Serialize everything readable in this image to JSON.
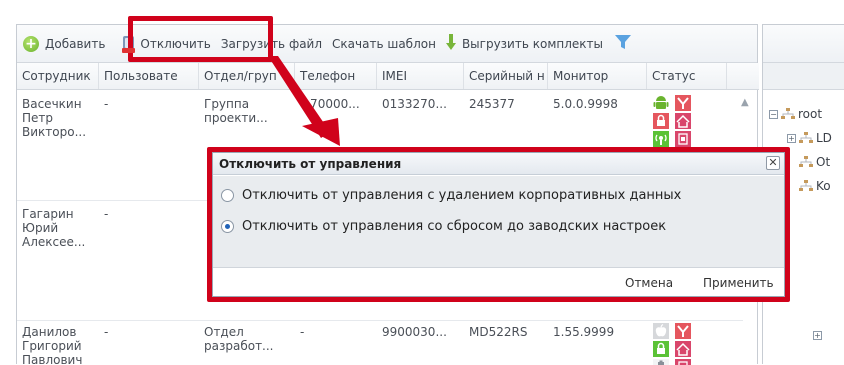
{
  "toolbar": {
    "add_label": "Добавить",
    "disable_label": "Отключить",
    "upload_label": "Загрузить файл",
    "download_template_label": "Скачать шаблон",
    "export_label": "Выгрузить комплекты"
  },
  "columns": [
    "Сотрудник",
    "Пользовате",
    "Отдел/груп",
    "Телефон",
    "IMEI",
    "Серийный н",
    "Монитор",
    "Статус"
  ],
  "rows": [
    {
      "employee": "Васечкин\nПетр\nВикторо...",
      "user": "-",
      "department": "Группа\nпроекти...",
      "phone": "+70000...",
      "imei": "0133270...",
      "serial": "245377",
      "monitor": "5.0.0.9998",
      "status_icons": [
        "android-icon",
        "antenna-icon",
        "lock-icon",
        "wifi-icon",
        "signal-icon",
        "sim-icon"
      ]
    },
    {
      "employee": "Гагарин\nЮрий\nАлексее...",
      "user": "-",
      "department": "",
      "phone": "",
      "imei": "",
      "serial": "",
      "monitor": "",
      "status_icons": []
    },
    {
      "employee": "Данилов\nГригорий\nПавлович",
      "user": "-",
      "department": "Отдел\nразработ...",
      "phone": "-",
      "imei": "9900030...",
      "serial": "MD522RS",
      "monitor": "1.55.9999",
      "status_icons": [
        "apple-icon",
        "antenna-icon",
        "lock-icon",
        "wifi-icon",
        "battery-icon",
        "sim-icon"
      ]
    }
  ],
  "tree": {
    "root_label": "root",
    "node_1": "LD",
    "node_2": "Ot",
    "node_3": "Ko"
  },
  "dialog": {
    "title": "Отключить от управления",
    "close_glyph": "✕",
    "option_1": "Отключить от управления с удалением корпоративных данных",
    "option_2": "Отключить от управления со сбросом до заводских настроек",
    "selected_option": 2,
    "cancel_label": "Отмена",
    "apply_label": "Применить"
  },
  "colors": {
    "highlight": "#d0021b",
    "accent_green": "#6ab42e",
    "accent_blue": "#2163b8"
  }
}
